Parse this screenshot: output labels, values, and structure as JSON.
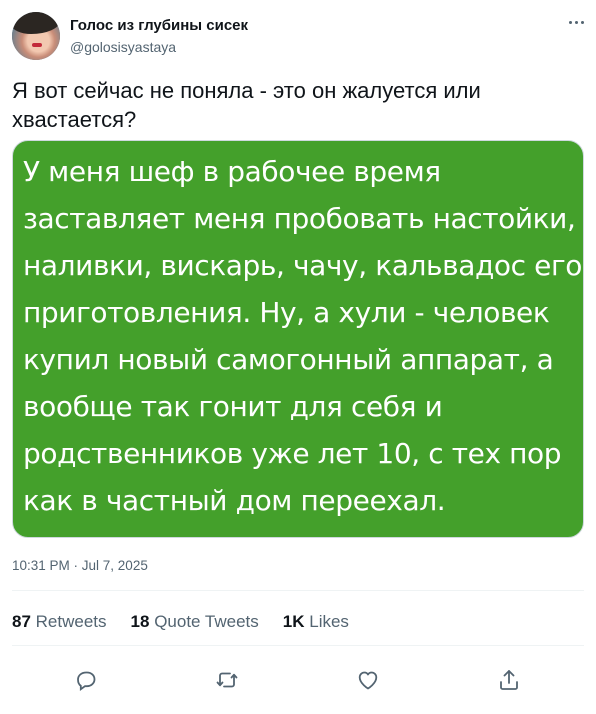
{
  "author": {
    "name": "Голос из глубины сисек",
    "handle": "@golosisyastaya"
  },
  "tweet": {
    "text": "Я вот сейчас не поняла - это он жалуется или хвастается?",
    "image_text_lines": [
      "У меня шеф в рабочее время",
      "заставляет меня пробовать настойки,",
      "наливки, вискарь, чачу, кальвадос его",
      "приготовления. Ну, а хули - человек",
      "купил новый самогонный аппарат, а",
      "вообще так гонит для себя и",
      "родственников уже лет 10, с тех пор",
      "как в частный дом переехал."
    ],
    "timestamp": "10:31 PM · Jul 7, 2025"
  },
  "stats": {
    "retweets_count": "87",
    "retweets_label": "Retweets",
    "quotes_count": "18",
    "quotes_label": "Quote Tweets",
    "likes_count": "1K",
    "likes_label": "Likes"
  },
  "actions": [
    "reply-icon",
    "retweet-icon",
    "like-icon",
    "share-icon"
  ],
  "colors": {
    "image_background": "#44a02b",
    "secondary_text": "#536471",
    "primary_text": "#0f1419"
  }
}
